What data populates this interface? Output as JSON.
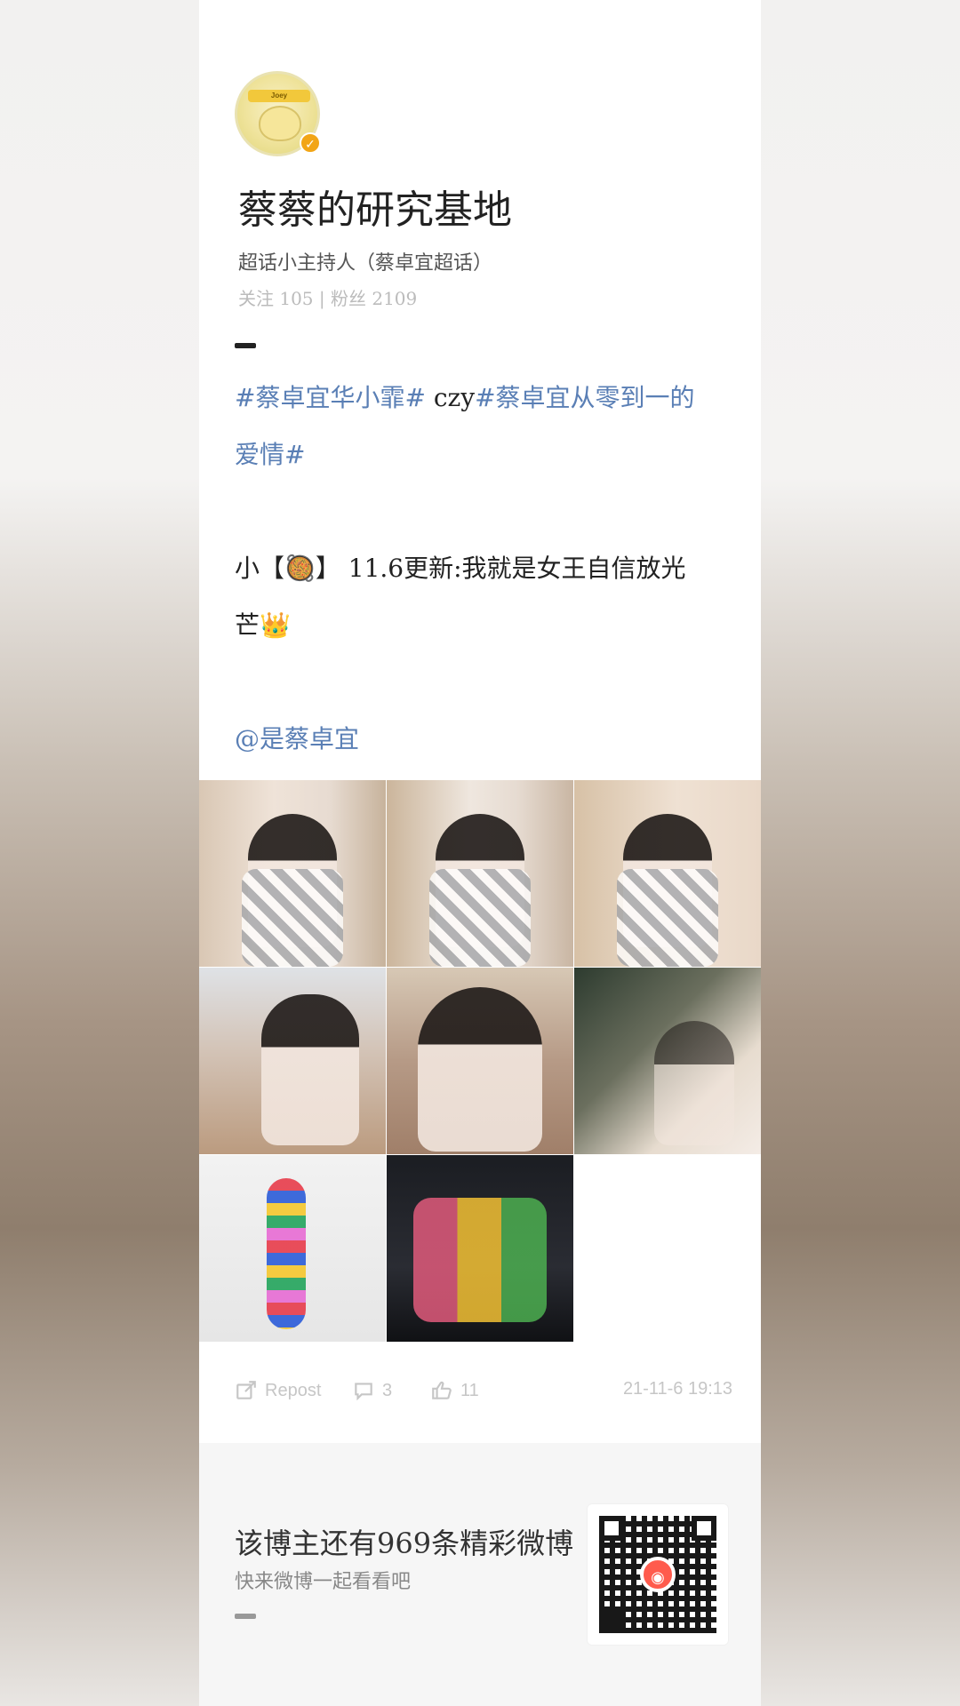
{
  "profile": {
    "name": "蔡蔡的研究基地",
    "subtitle": "超话小主持人（蔡卓宜超话）",
    "stats": "关注 105 | 粉丝 2109",
    "avatar_text": "Joey"
  },
  "post": {
    "line1_hashtag1": "#蔡卓宜华小霏#",
    "line1_text": " czy",
    "line1_hashtag2": "#蔡卓宜从零到一的",
    "line2_hashtag2": "爱情#",
    "line3": "小【🥘】 11.6更新:我就是女王自信放光",
    "line4": "芒👑",
    "mention": "@是蔡卓宜"
  },
  "actions": {
    "repost_label": "Repost",
    "comment_count": "3",
    "like_count": "11",
    "timestamp": "21-11-6 19:13"
  },
  "footer": {
    "promo_main": "该博主还有969条精彩微博",
    "promo_sub": "快来微博一起看看吧"
  },
  "icons": {
    "repost": "repost-icon",
    "comment": "comment-icon",
    "like": "like-icon",
    "qr": "qr-code"
  }
}
